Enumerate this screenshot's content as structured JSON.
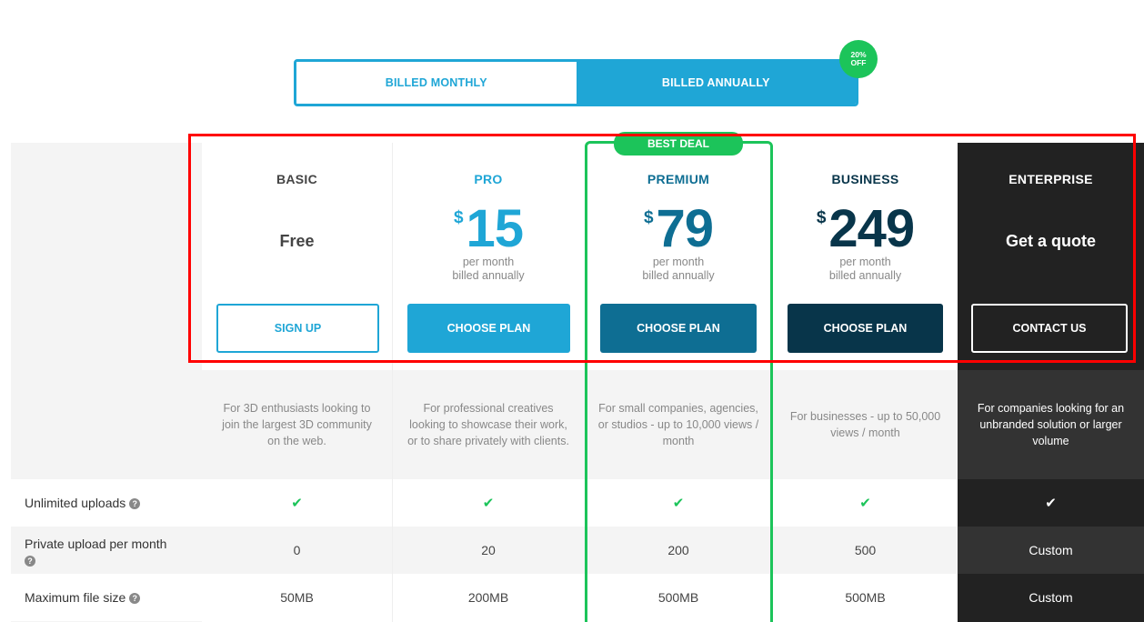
{
  "billing": {
    "monthly_label": "BILLED MONTHLY",
    "annual_label": "BILLED ANNUALLY",
    "selected": "annual",
    "discount_line1": "20%",
    "discount_line2": "OFF"
  },
  "best_deal_label": "BEST DEAL",
  "plans": [
    {
      "name": "BASIC",
      "price_text": "Free",
      "button": "SIGN UP",
      "description": "For 3D enthusiasts looking to join the largest 3D community on the web.",
      "name_color": "#444444",
      "button_bg": "#ffffff",
      "button_text_color": "#1fa6d6"
    },
    {
      "name": "PRO",
      "currency": "$",
      "price": "15",
      "per_line1": "per month",
      "per_line2": "billed annually",
      "button": "CHOOSE PLAN",
      "description": "For professional creatives looking to showcase their work, or to share privately with clients.",
      "name_color": "#1fa6d6",
      "button_bg": "#1fa6d6"
    },
    {
      "name": "PREMIUM",
      "currency": "$",
      "price": "79",
      "per_line1": "per month",
      "per_line2": "billed annually",
      "button": "CHOOSE PLAN",
      "description": "For small companies, agencies, or studios - up to 10,000 views / month",
      "name_color": "#0e6e93",
      "button_bg": "#0e6e93"
    },
    {
      "name": "BUSINESS",
      "currency": "$",
      "price": "249",
      "per_line1": "per month",
      "per_line2": "billed annually",
      "button": "CHOOSE PLAN",
      "description": "For businesses - up to 50,000 views / month",
      "name_color": "#08354a",
      "button_bg": "#08354a"
    },
    {
      "name": "ENTERPRISE",
      "price_text": "Get a quote",
      "button": "CONTACT US",
      "description": "For companies looking for an unbranded solution or larger volume",
      "name_color": "#ffffff",
      "button_bg": "#222222"
    }
  ],
  "features": [
    {
      "label": "Unlimited uploads",
      "icon": "question-circle-icon",
      "values": [
        "check-icon",
        "check-icon",
        "check-icon",
        "check-icon",
        "check-icon"
      ]
    },
    {
      "label": "Private upload per month",
      "icon": "question-circle-icon",
      "values": [
        "0",
        "20",
        "200",
        "500",
        "Custom"
      ]
    },
    {
      "label": "Maximum file size",
      "icon": "question-circle-icon",
      "values": [
        "50MB",
        "200MB",
        "500MB",
        "500MB",
        "Custom"
      ]
    }
  ],
  "colors": {
    "accent_blue": "#1fa6d6",
    "premium_teal": "#0e6e93",
    "business_navy": "#08354a",
    "success_green": "#1cc45a",
    "enterprise_dark": "#222222",
    "annotation_red": "#ff0000"
  }
}
